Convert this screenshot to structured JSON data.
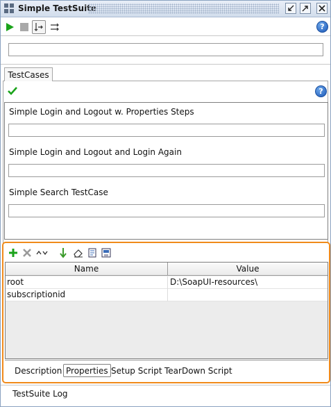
{
  "window": {
    "title": "Simple TestSuite"
  },
  "toolbar": {
    "run_icon": "play-icon",
    "stop_icon": "stop-icon",
    "sequential_icon": "sequential-run-icon",
    "parallel_icon": "parallel-run-icon",
    "help_label": "?"
  },
  "description_field": {
    "value": ""
  },
  "tabs": {
    "testcases_label": "TestCases"
  },
  "testcases": {
    "items": [
      {
        "label": "Simple Login and Logout w. Properties Steps",
        "progress_value": ""
      },
      {
        "label": "Simple Login and Logout and Login Again",
        "progress_value": ""
      },
      {
        "label": "Simple Search TestCase",
        "progress_value": ""
      }
    ],
    "help_label": "?"
  },
  "properties": {
    "columns": {
      "name": "Name",
      "value": "Value"
    },
    "rows": [
      {
        "name": "root",
        "value": "D:\\SoapUI-resources\\"
      },
      {
        "name": "subscriptionid",
        "value": ""
      }
    ],
    "subtabs": [
      "Description",
      "Properties",
      "Setup Script",
      "TearDown Script"
    ],
    "active_subtab": "Properties"
  },
  "bottom": {
    "log_label": "TestSuite Log"
  },
  "colors": {
    "accent_orange": "#f08a1a",
    "run_green": "#1aa31a",
    "help_blue": "#1c58b8"
  }
}
